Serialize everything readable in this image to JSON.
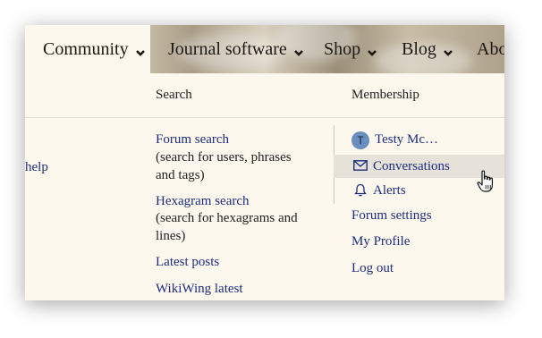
{
  "nav": {
    "items": [
      {
        "label": "Community"
      },
      {
        "label": "Journal software"
      },
      {
        "label": "Shop"
      },
      {
        "label": "Blog"
      },
      {
        "label": "Abo"
      }
    ]
  },
  "left_partial_link": "help",
  "search_col": {
    "heading": "Search",
    "forum_search": {
      "label": "Forum search",
      "desc_line1": "(search for users, phrases",
      "desc_line2": "and tags)"
    },
    "hexagram_search": {
      "label": "Hexagram search",
      "desc_line1": "(search for hexagrams and",
      "desc_line2": "lines)"
    },
    "latest_posts": "Latest posts",
    "wikiwing_latest": "WikiWing latest"
  },
  "membership_col": {
    "heading": "Membership",
    "avatar_letter": "T",
    "username": "Testy Mc…",
    "conversations": "Conversations",
    "alerts": "Alerts",
    "forum_settings": "Forum settings",
    "my_profile": "My Profile",
    "log_out": "Log out"
  },
  "colors": {
    "link": "#1d2c7d",
    "panel_bg": "#fdf8ee",
    "highlight": "#e6e2d9",
    "avatar": "#6a8fbf"
  }
}
